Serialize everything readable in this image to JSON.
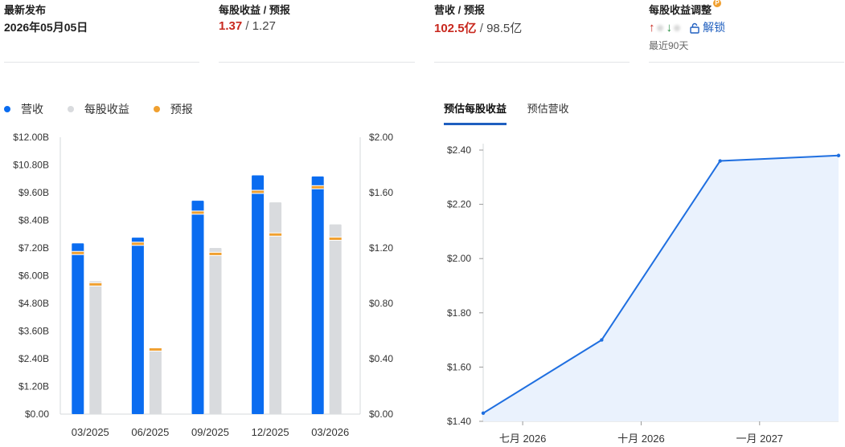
{
  "stats": {
    "latest": {
      "label": "最新发布",
      "value": "2026年05月05日"
    },
    "eps": {
      "label": "每股收益 / 预报",
      "actual": "1.37",
      "separator": " / ",
      "estimate": "1.27"
    },
    "revenue": {
      "label": "营收 / 预报",
      "actual": "102.5亿",
      "separator": " / ",
      "estimate": "98.5亿"
    },
    "revisions": {
      "label": "每股收益调整",
      "badge": "P",
      "up_arrow": "↑",
      "down_arrow": "↓",
      "unlock_label": "解锁",
      "note": "最近90天"
    }
  },
  "legend": [
    {
      "label": "营收",
      "color": "#0a6cf0"
    },
    {
      "label": "每股收益",
      "color": "#d9dbde"
    },
    {
      "label": "预报",
      "color": "#f0a030"
    }
  ],
  "tabs": [
    {
      "label": "预估每股收益",
      "active": true
    },
    {
      "label": "预估营收",
      "active": false
    }
  ],
  "colors": {
    "revenue": "#0a6cf0",
    "eps": "#d9dbde",
    "forecast": "#f0a030",
    "line": "#1f6fe0",
    "area": "#eaf2fd",
    "accent": "#1f5fbf",
    "positive": "#c8281e"
  },
  "chart_data": [
    {
      "type": "bar",
      "categories": [
        "03/2025",
        "06/2025",
        "09/2025",
        "12/2025",
        "03/2026"
      ],
      "left_ticks": [
        "$0.00",
        "$1.20B",
        "$2.40B",
        "$3.60B",
        "$4.80B",
        "$6.00B",
        "$7.20B",
        "$8.40B",
        "$9.60B",
        "$10.80B",
        "$12.00B"
      ],
      "right_ticks": [
        "$0.00",
        "$0.40",
        "$0.80",
        "$1.20",
        "$1.60",
        "$2.00"
      ],
      "ylim_left": [
        0,
        12
      ],
      "ylim_right": [
        0,
        2
      ],
      "series": [
        {
          "name": "营收",
          "axis": "left",
          "values": [
            7.4,
            7.65,
            9.25,
            10.35,
            10.3
          ]
        },
        {
          "name": "预报",
          "axis": "left",
          "values": [
            7.0,
            7.4,
            8.75,
            9.65,
            9.85
          ]
        },
        {
          "name": "每股收益",
          "axis": "right",
          "values": [
            0.96,
            0.47,
            1.2,
            1.53,
            1.37
          ]
        },
        {
          "name": "预报",
          "axis": "right",
          "values": [
            0.94,
            0.47,
            1.16,
            1.3,
            1.27
          ]
        }
      ]
    },
    {
      "type": "area",
      "x_ticks": [
        "七月 2026",
        "十月 2026",
        "一月 2027"
      ],
      "y_ticks": [
        "$1.40",
        "$1.60",
        "$1.80",
        "$2.00",
        "$2.20",
        "$2.40"
      ],
      "ylim": [
        1.4,
        2.4
      ],
      "xlim": [
        "2026-06",
        "2027-03"
      ],
      "points": [
        {
          "x": "2026-06",
          "y": 1.43
        },
        {
          "x": "2026-09",
          "y": 1.7
        },
        {
          "x": "2026-12",
          "y": 2.36
        },
        {
          "x": "2027-03",
          "y": 2.38
        }
      ]
    }
  ]
}
